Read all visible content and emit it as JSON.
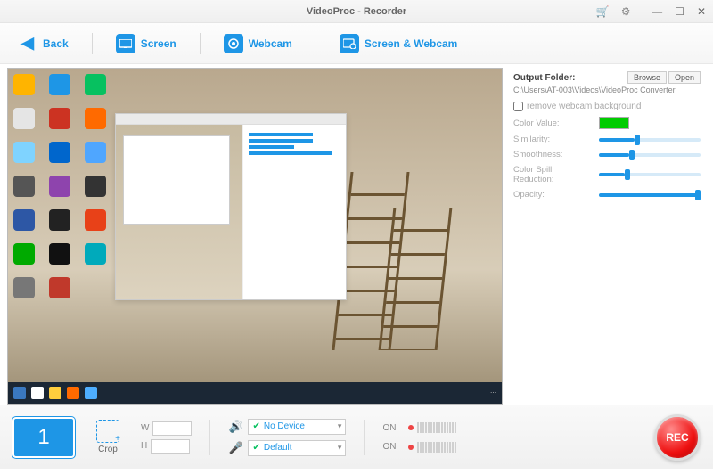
{
  "app": {
    "title": "VideoProc - Recorder"
  },
  "toolbar": {
    "back": "Back",
    "screen": "Screen",
    "webcam": "Webcam",
    "screen_webcam": "Screen & Webcam"
  },
  "panel": {
    "output_label": "Output Folder:",
    "browse": "Browse",
    "open": "Open",
    "path": "C:\\Users\\AT-003\\Videos\\VideoProc Converter",
    "remove_bg": "remove webcam background",
    "color_value": "Color Value:",
    "color_hex": "#00cc00",
    "similarity": "Similarity:",
    "similarity_pct": 35,
    "smoothness": "Smoothness:",
    "smoothness_pct": 30,
    "spill": "Color Spill Reduction:",
    "spill_pct": 25,
    "opacity": "Opacity:",
    "opacity_pct": 100
  },
  "bottom": {
    "display_number": "1",
    "crop": "Crop",
    "w_label": "W",
    "h_label": "H",
    "w_value": "",
    "h_value": "",
    "audio_device": "No Device",
    "mic_device": "Default",
    "toggle1": "ON",
    "toggle2": "ON",
    "rec": "REC"
  }
}
